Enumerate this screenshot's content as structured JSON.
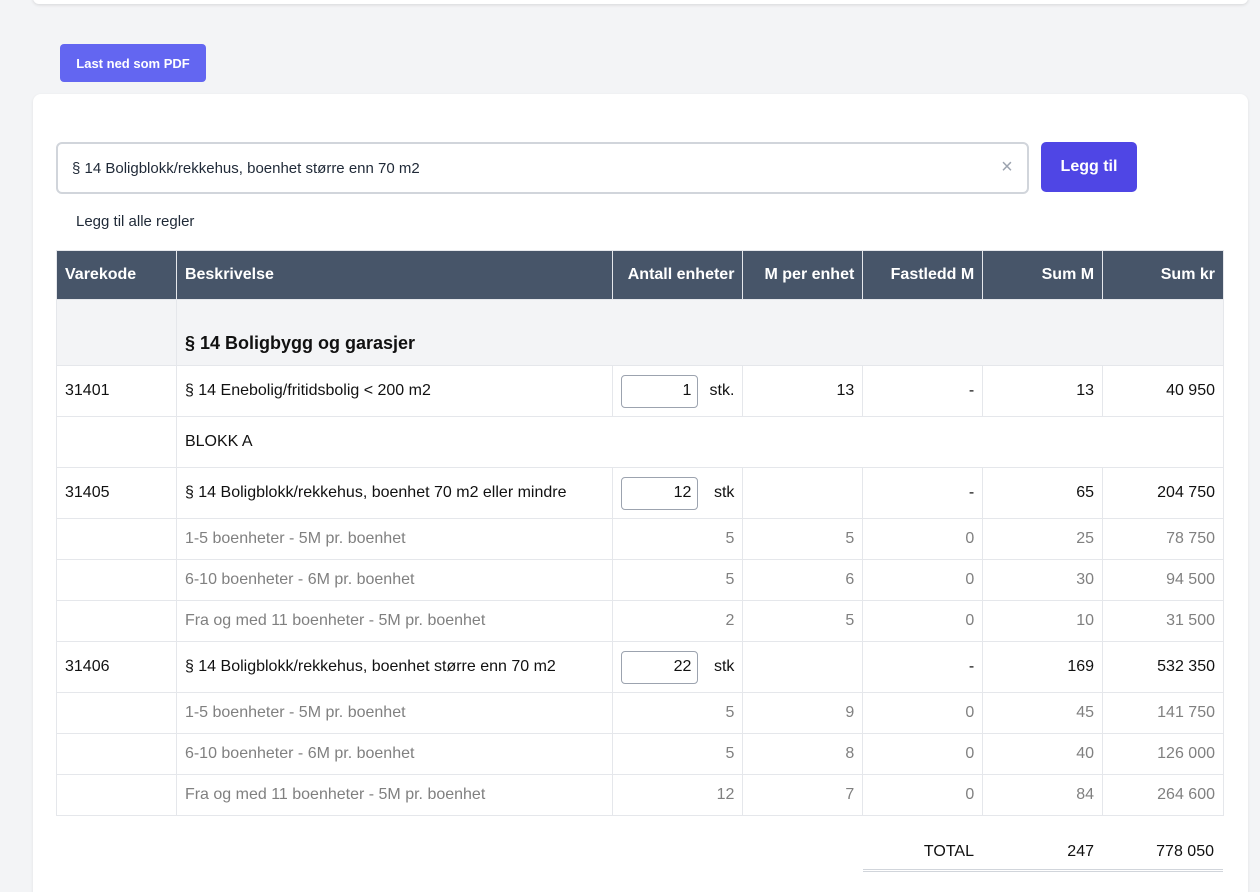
{
  "actions": {
    "download_pdf_label": "Last ned som PDF",
    "add_label": "Legg til",
    "add_all_label": "Legg til alle regler"
  },
  "search": {
    "value": "§ 14 Boligblokk/rekkehus, boenhet større enn 70 m2",
    "clear_icon": "×"
  },
  "table": {
    "headers": {
      "varekode": "Varekode",
      "beskrivelse": "Beskrivelse",
      "antall": "Antall enheter",
      "m_per_enhet": "M per enhet",
      "fastledd": "Fastledd M",
      "sum_m": "Sum M",
      "sum_kr": "Sum kr"
    },
    "group_title": "§ 14 Boligbygg og garasjer",
    "row_31401": {
      "code": "31401",
      "desc": "§ 14 Enebolig/fritidsbolig < 200 m2",
      "qty": "1",
      "unit": "stk.",
      "m_per": "13",
      "fastledd": "-",
      "sum_m": "13",
      "sum_kr": "40 950"
    },
    "block_label": "BLOKK A",
    "row_31405": {
      "code": "31405",
      "desc": "§ 14 Boligblokk/rekkehus, boenhet 70 m2 eller mindre",
      "qty": "12",
      "unit": "stk",
      "m_per": "",
      "fastledd": "-",
      "sum_m": "65",
      "sum_kr": "204 750",
      "subs": [
        {
          "desc": "1-5 boenheter - 5M pr. boenhet",
          "qty": "5",
          "m_per": "5",
          "fastledd": "0",
          "sum_m": "25",
          "sum_kr": "78 750"
        },
        {
          "desc": "6-10 boenheter - 6M pr. boenhet",
          "qty": "5",
          "m_per": "6",
          "fastledd": "0",
          "sum_m": "30",
          "sum_kr": "94 500"
        },
        {
          "desc": "Fra og med 11 boenheter - 5M pr. boenhet",
          "qty": "2",
          "m_per": "5",
          "fastledd": "0",
          "sum_m": "10",
          "sum_kr": "31 500"
        }
      ]
    },
    "row_31406": {
      "code": "31406",
      "desc": "§ 14 Boligblokk/rekkehus, boenhet større enn 70 m2",
      "qty": "22",
      "unit": "stk",
      "m_per": "",
      "fastledd": "-",
      "sum_m": "169",
      "sum_kr": "532 350",
      "subs": [
        {
          "desc": "1-5 boenheter - 5M pr. boenhet",
          "qty": "5",
          "m_per": "9",
          "fastledd": "0",
          "sum_m": "45",
          "sum_kr": "141 750"
        },
        {
          "desc": "6-10 boenheter - 6M pr. boenhet",
          "qty": "5",
          "m_per": "8",
          "fastledd": "0",
          "sum_m": "40",
          "sum_kr": "126 000"
        },
        {
          "desc": "Fra og med 11 boenheter - 5M pr. boenhet",
          "qty": "12",
          "m_per": "7",
          "fastledd": "0",
          "sum_m": "84",
          "sum_kr": "264 600"
        }
      ]
    }
  },
  "totals": {
    "label": "TOTAL",
    "sum_m": "247",
    "sum_kr": "778 050"
  },
  "colors": {
    "header_bg": "#475569",
    "primary_button": "#4f46e5",
    "pdf_button": "#6366f1"
  }
}
